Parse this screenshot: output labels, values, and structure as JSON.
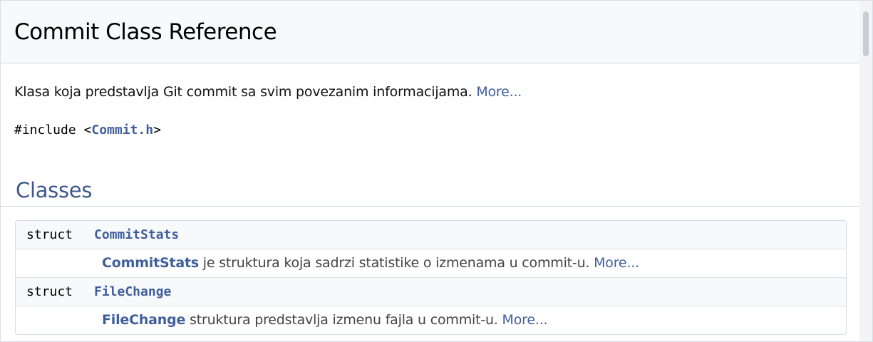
{
  "header": {
    "title": "Commit Class Reference"
  },
  "brief": {
    "text": "Klasa koja predstavlja Git commit sa svim povezanim informacijama.",
    "more": "More..."
  },
  "include": {
    "prefix": "#include <",
    "file": "Commit.h",
    "suffix": ">"
  },
  "classes_section": {
    "title": "Classes",
    "rows": [
      {
        "keyword": "struct",
        "name": "CommitStats",
        "desc_ref": "CommitStats",
        "desc_text": " je struktura koja sadrzi statistike o izmenama u commit-u.",
        "more": "More..."
      },
      {
        "keyword": "struct",
        "name": "FileChange",
        "desc_ref": "FileChange",
        "desc_text": " struktura predstavlja izmenu fajla u commit-u.",
        "more": "More..."
      }
    ]
  },
  "colors": {
    "link": "#3f5f9a",
    "section_title": "#3d578c",
    "header_bg": "#f8f9fb"
  }
}
